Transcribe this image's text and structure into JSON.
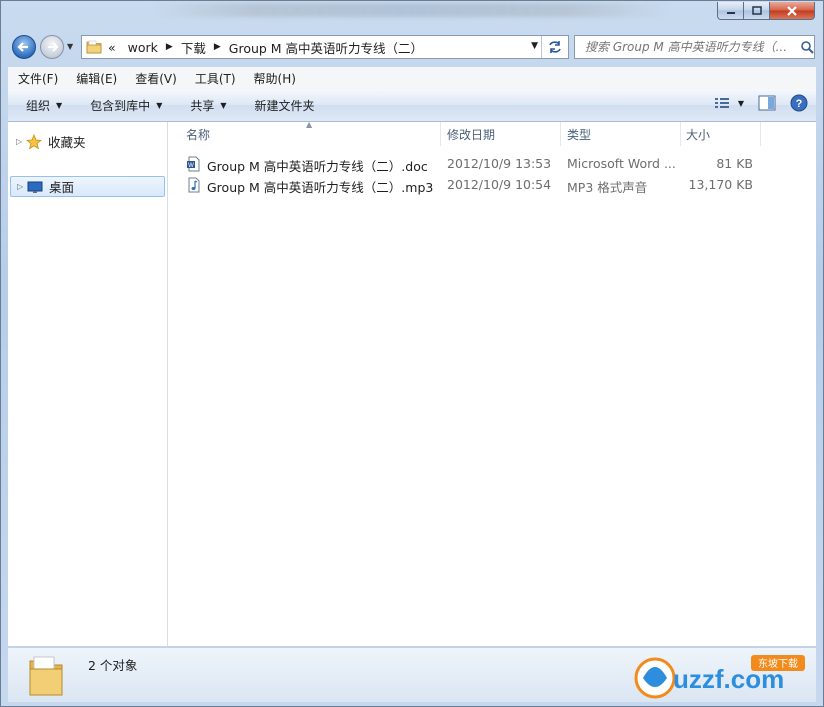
{
  "window": {
    "titlebar_buttons": {
      "minimize": "–",
      "maximize": "□",
      "close": "✕"
    }
  },
  "address": {
    "overflow": "«",
    "crumbs": [
      "work",
      "下载",
      "Group M 高中英语听力专线（二）"
    ],
    "search_placeholder": "搜索 Group M 高中英语听力专线（..."
  },
  "menu": [
    "文件(F)",
    "编辑(E)",
    "查看(V)",
    "工具(T)",
    "帮助(H)"
  ],
  "toolbar": {
    "organize": "组织",
    "include_in_library": "包含到库中",
    "share": "共享",
    "new_folder": "新建文件夹"
  },
  "nav_pane": {
    "favorites": "收藏夹",
    "desktop": "桌面"
  },
  "columns": {
    "name": "名称",
    "date": "修改日期",
    "type": "类型",
    "size": "大小"
  },
  "files": [
    {
      "name": "Group M 高中英语听力专线（二）.doc",
      "date": "2012/10/9 13:53",
      "type": "Microsoft Word ...",
      "size": "81 KB",
      "icon": "word-doc-icon"
    },
    {
      "name": "Group M 高中英语听力专线（二）.mp3",
      "date": "2012/10/9 10:54",
      "type": "MP3 格式声音",
      "size": "13,170 KB",
      "icon": "audio-file-icon"
    }
  ],
  "status": {
    "count_text": "2 个对象"
  },
  "watermark": {
    "text": "uzzf.com",
    "badge": "东坡下载"
  }
}
